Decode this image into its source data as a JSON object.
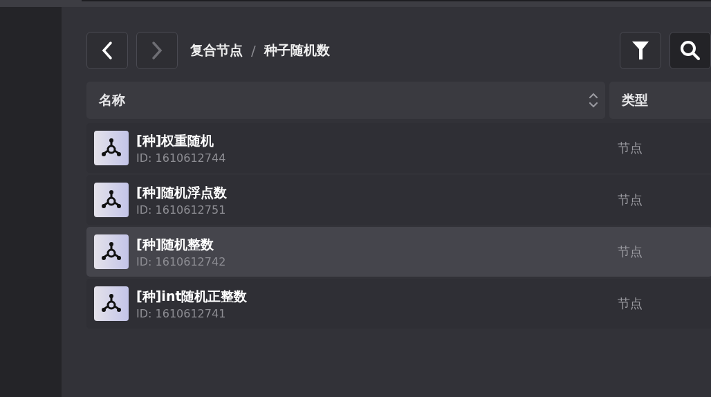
{
  "navigation": {
    "back": {
      "disabled": false
    },
    "forward": {
      "disabled": true
    }
  },
  "breadcrumb": [
    "复合节点",
    "种子随机数"
  ],
  "breadcrumb_separator": "/",
  "table": {
    "columns": [
      {
        "label": "名称",
        "sortable": true
      },
      {
        "label": "类型",
        "sortable": false
      }
    ],
    "rows": [
      {
        "name": "[种]权重随机",
        "id": "ID: 1610612744",
        "type": "节点",
        "selected": false
      },
      {
        "name": "[种]随机浮点数",
        "id": "ID: 1610612751",
        "type": "节点",
        "selected": false
      },
      {
        "name": "[种]随机整数",
        "id": "ID: 1610612742",
        "type": "节点",
        "selected": true
      },
      {
        "name": "[种]int随机正整数",
        "id": "ID: 1610612741",
        "type": "节点",
        "selected": false
      }
    ]
  }
}
